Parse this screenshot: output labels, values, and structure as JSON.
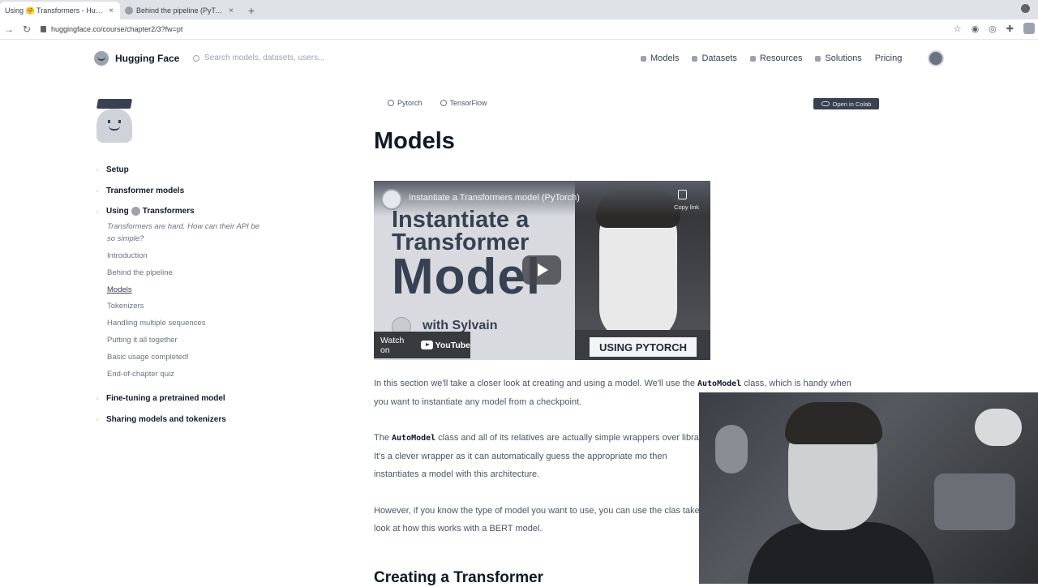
{
  "browser": {
    "tabs": [
      {
        "title": "Using 🤗 Transformers - Huggin",
        "active": true
      },
      {
        "title": "Behind the pipeline (PyTorch) - C",
        "active": false
      }
    ],
    "url": "huggingface.co/course/chapter2/3?fw=pt"
  },
  "navbar": {
    "brand": "Hugging Face",
    "search_placeholder": "Search models, datasets, users...",
    "menu": [
      "Models",
      "Datasets",
      "Resources",
      "Solutions",
      "Pricing"
    ]
  },
  "sidebar": {
    "sections": [
      {
        "label": "Setup"
      },
      {
        "label": "Transformer models"
      }
    ],
    "current": {
      "label_pre": "Using",
      "label_post": "Transformers",
      "description": "Transformers are hard. How can their API be so simple?",
      "items": [
        {
          "label": "Introduction",
          "active": false
        },
        {
          "label": "Behind the pipeline",
          "active": false
        },
        {
          "label": "Models",
          "active": true
        },
        {
          "label": "Tokenizers",
          "active": false
        },
        {
          "label": "Handling multiple sequences",
          "active": false
        },
        {
          "label": "Putting it all together",
          "active": false
        },
        {
          "label": "Basic usage completed!",
          "active": false
        },
        {
          "label": "End-of-chapter quiz",
          "active": false
        }
      ]
    },
    "after_sections": [
      {
        "label": "Fine-tuning a pretrained model"
      },
      {
        "label": "Sharing models and tokenizers"
      }
    ]
  },
  "main": {
    "framework_tabs": [
      "Pytorch",
      "TensorFlow"
    ],
    "colab_label": "Open in Colab",
    "title": "Models",
    "video": {
      "title": "Instantiate a Transformers model (PyTorch)",
      "copy_label": "Copy link",
      "big_line1": "Instantiate a",
      "big_line2": "Transformer",
      "big_line3": "Model",
      "with_text": "with Sylvain",
      "watch_on": "Watch on",
      "youtube": "YouTube",
      "badge": "USING PYTORCH"
    },
    "paragraphs": [
      {
        "pre": "In this section we'll take a closer look at creating and using a model. We'll use the ",
        "code": "AutoModel",
        "post": " class, which is handy when you want to instantiate any model from a checkpoint."
      },
      {
        "pre": "The ",
        "code": "AutoModel",
        "post": " class and all of its relatives are actually simple wrappers over library. It's a clever wrapper as it can automatically guess the appropriate mo then instantiates a model with this architecture."
      },
      {
        "pre": "However, if you know the type of model you want to use, you can use the clas take a look at how this works with a BERT model.",
        "code": "",
        "post": ""
      }
    ],
    "heading": "Creating a Transformer"
  }
}
